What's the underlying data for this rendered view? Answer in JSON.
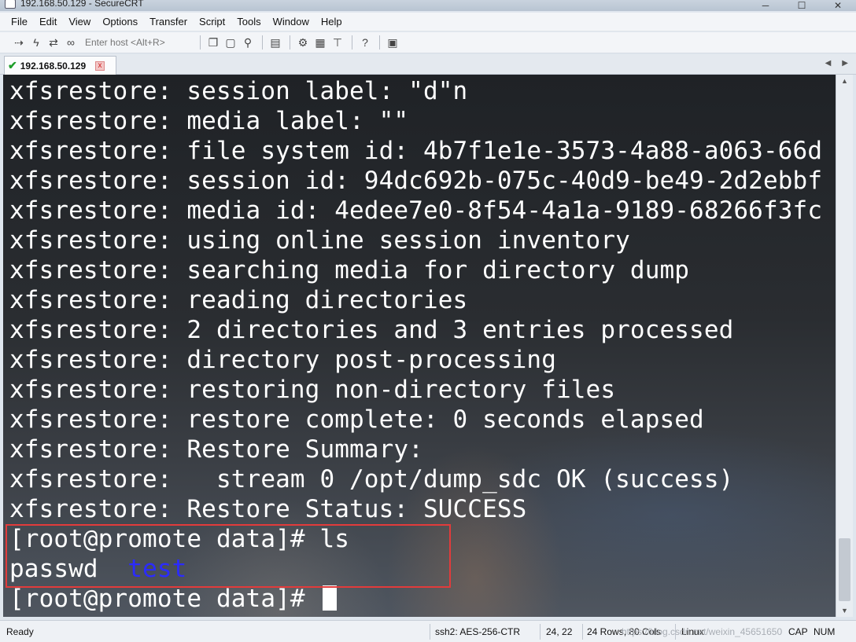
{
  "window": {
    "title": "192.168.50.129 - SecureCRT",
    "minimize": "─",
    "maximize": "☐",
    "close": "✕"
  },
  "menu": [
    "File",
    "Edit",
    "View",
    "Options",
    "Transfer",
    "Script",
    "Tools",
    "Window",
    "Help"
  ],
  "toolbar": {
    "host_placeholder": "Enter host <Alt+R>",
    "icons": [
      "connect-bar-icon",
      "lightning-connect-icon",
      "reconnect-icon",
      "disconnect-icon",
      "copy-icon",
      "paste-icon",
      "find-icon",
      "print-icon",
      "settings-icon",
      "keymap-icon",
      "sftp-icon",
      "help-icon",
      "screenshot-icon"
    ]
  },
  "tab": {
    "label": "192.168.50.129",
    "close": "x",
    "status_color": "#1e9e2a"
  },
  "terminal": {
    "lines": [
      "xfsrestore: session label: \"d\"n",
      "xfsrestore: media label: \"\"",
      "xfsrestore: file system id: 4b7f1e1e-3573-4a88-a063-66d",
      "xfsrestore: session id: 94dc692b-075c-40d9-be49-2d2ebbf",
      "xfsrestore: media id: 4edee7e0-8f54-4a1a-9189-68266f3fc",
      "xfsrestore: using online session inventory",
      "xfsrestore: searching media for directory dump",
      "xfsrestore: reading directories",
      "xfsrestore: 2 directories and 3 entries processed",
      "xfsrestore: directory post-processing",
      "xfsrestore: restoring non-directory files",
      "xfsrestore: restore complete: 0 seconds elapsed",
      "xfsrestore: Restore Summary:",
      "xfsrestore:   stream 0 /opt/dump_sdc OK (success)",
      "xfsrestore: Restore Status: SUCCESS",
      "[root@promote data]# ls"
    ],
    "ls_file": "passwd",
    "ls_dir": "test",
    "prompt": "[root@promote data]# ",
    "directory_color": "#2b2bff",
    "highlight_color": "#e23b3b"
  },
  "status": {
    "ready": "Ready",
    "cipher": "ssh2: AES-256-CTR",
    "position": "24,  22",
    "size": "24 Rows, 80 Cols",
    "os": "Linux",
    "watermark": "https://blog.csdn.net/weixin_45651650",
    "cap": "CAP",
    "num": "NUM"
  }
}
